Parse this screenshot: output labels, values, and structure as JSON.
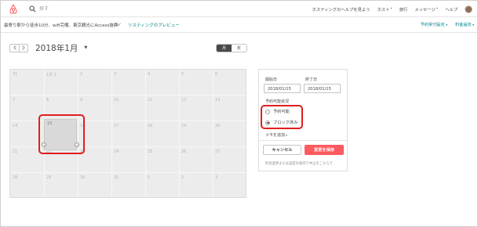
{
  "colors": {
    "brand": "#ff5a5f",
    "accent": "#008489",
    "highlight": "#e01e1e"
  },
  "topnav": {
    "logo_icon": "airbnb-logo-icon",
    "search_icon": "search-icon",
    "search_text": "探す",
    "host_help": "ホスティングのヘルプを見よう",
    "host": "ホスト",
    "trips": "旅行",
    "messages": "メッセージ",
    "help": "ヘルプ"
  },
  "subnav": {
    "listing_name": "最寄り駅から徒歩10分、wifi完備、東京観光にAccess抜群",
    "preview": "リスティングのプレビュー",
    "booking_settings": "予約受付設定",
    "pricing_settings": "料金設定"
  },
  "calendar": {
    "month_title": "2018年1月",
    "view_month": "月",
    "view_year": "年",
    "days": [
      [
        "31",
        "1月 1",
        "2",
        "3",
        "4",
        "5",
        "6"
      ],
      [
        "7",
        "8",
        "9",
        "10",
        "11",
        "12",
        "13"
      ],
      [
        "14",
        "15",
        "16",
        "17",
        "18",
        "19",
        "20"
      ],
      [
        "21",
        "22",
        "23",
        "24",
        "25",
        "26",
        "27"
      ],
      [
        "28",
        "29",
        "30",
        "31",
        "1",
        "2",
        "3"
      ]
    ],
    "selected_day": "15"
  },
  "panel": {
    "start_label": "開始日",
    "end_label": "終了日",
    "start_date": "2018/01/15",
    "end_date": "2018/01/15",
    "availability_label": "予約可能状況",
    "option_available": "予約可能",
    "option_blocked": "ブロック済み",
    "selected_option": "ブロック済み",
    "memo": "メモを追加",
    "cancel": "キャンセル",
    "save": "変更を保存",
    "note": "料金変更または設定の保持で中止をこちらで"
  }
}
